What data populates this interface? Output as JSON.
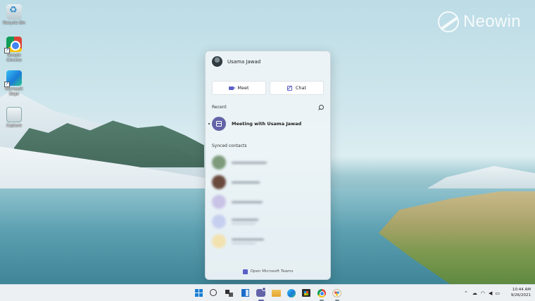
{
  "desktop": {
    "icons": [
      {
        "label": "Recycle Bin",
        "icon": "recycle-bin-icon"
      },
      {
        "label": "Google Chrome",
        "icon": "chrome-icon"
      },
      {
        "label": "Microsoft Edge",
        "icon": "edge-icon"
      },
      {
        "label": "Capture",
        "icon": "capture-icon"
      }
    ]
  },
  "watermark": {
    "text": "Neowin"
  },
  "flyout": {
    "user_name": "Usama Jawad",
    "meet_label": "Meet",
    "chat_label": "Chat",
    "recent_label": "Recent",
    "recent_items": [
      {
        "title": "Meeting with Usama Jawad",
        "icon": "calendar-icon"
      }
    ],
    "synced_label": "Synced contacts",
    "contacts_avatar_colors": [
      "#7d9a7a",
      "#6b4a3e",
      "#c9c3e6",
      "#c7cff0",
      "#f2e2b0"
    ],
    "footer_label": "Open Microsoft Teams"
  },
  "taskbar": {
    "clock_time": "10:44 AM",
    "clock_date": "9/26/2021",
    "chat_badge_color": "#6264a7"
  },
  "colors": {
    "teams_purple": "#6264a7",
    "accent_blue": "#1a7fd4"
  }
}
